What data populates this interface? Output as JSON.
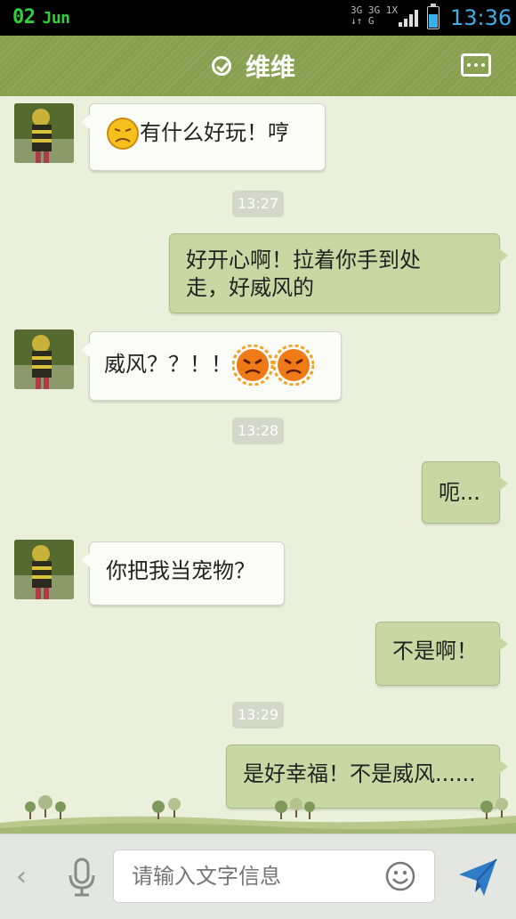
{
  "status_bar": {
    "day": "02",
    "month": "Jun",
    "network_top": "3G 3G 1X",
    "network_bottom": "↓↑ G",
    "time": "13:36",
    "battery_level": 0.7
  },
  "header": {
    "title": "维维"
  },
  "messages": [
    {
      "side": "in",
      "text": "有什么好玩！哼"
    },
    {
      "timestamp": "13:27"
    },
    {
      "side": "out",
      "line1": "好开心啊！拉着你手到处",
      "line2": "走，好威风的"
    },
    {
      "side": "in",
      "text": "威风？？！！"
    },
    {
      "timestamp": "13:28"
    },
    {
      "side": "out",
      "text": "呃..."
    },
    {
      "side": "in",
      "text": "你把我当宠物？"
    },
    {
      "side": "out",
      "text": "不是啊！"
    },
    {
      "timestamp": "13:29"
    },
    {
      "side": "out",
      "text": "是好幸福！不是威风......"
    }
  ],
  "input": {
    "placeholder": "请输入文字信息"
  },
  "colors": {
    "header": "#87a04f",
    "outgoing_bubble": "#c7d8a3",
    "incoming_bubble": "#fbfbf7",
    "time_accent": "#3ab0ea",
    "date_accent": "#2ed13a",
    "send": "#2e7cc8"
  },
  "icons": [
    "verified-icon",
    "more-icon",
    "back-icon",
    "mic-icon",
    "smiley-icon",
    "send-icon",
    "sad-emoji",
    "angry-sun-emoji"
  ]
}
